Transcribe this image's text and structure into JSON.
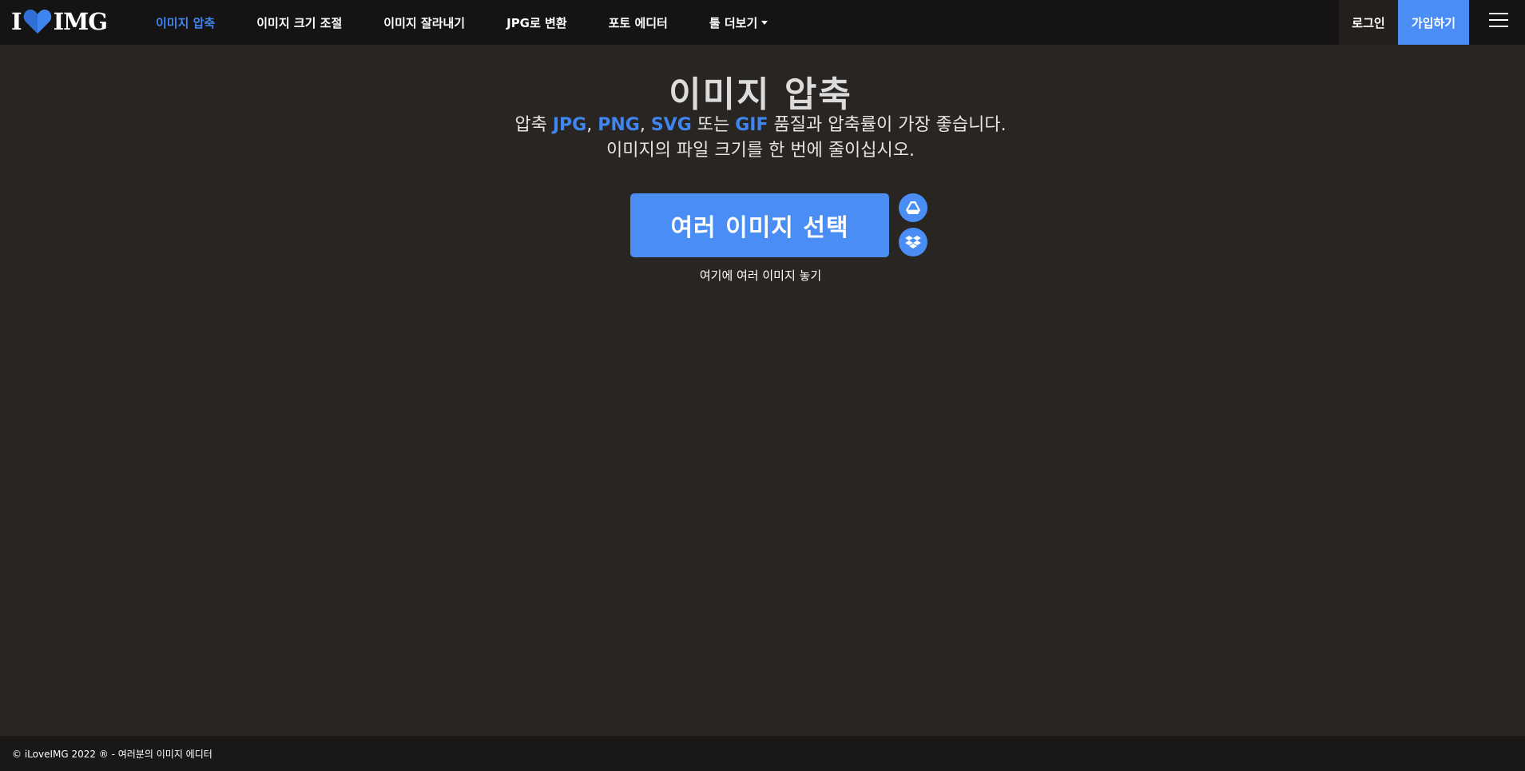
{
  "header": {
    "logo": {
      "left": "I",
      "right": "IMG"
    },
    "nav": [
      {
        "label": "이미지 압축",
        "active": true
      },
      {
        "label": "이미지 크기 조절"
      },
      {
        "label": "이미지 잘라내기"
      },
      {
        "label": "JPG로 변환"
      },
      {
        "label": "포토 에디터"
      },
      {
        "label": "툴 더보기",
        "dropdown": true
      }
    ],
    "login_label": "로그인",
    "signup_label": "가입하기",
    "menu_icon": "hamburger-menu-icon"
  },
  "main": {
    "title": "이미지 압축",
    "subtitle": {
      "prefix": "압축",
      "formats": [
        "JPG",
        "PNG",
        "SVG"
      ],
      "or": "또는",
      "last_format": "GIF",
      "suffix": "품질과 압축률이 가장 좋습니다.",
      "line2": "이미지의 파일 크기를 한 번에 줄이십시오."
    },
    "select_button_label": "여러 이미지 선택",
    "cloud_buttons": [
      "google-drive-icon",
      "dropbox-icon"
    ],
    "drop_hint": "여기에 여러 이미지 놓기"
  },
  "footer": {
    "text": "© iLoveIMG 2022 ® - 여러분의 이미지 에디터"
  },
  "colors": {
    "background": "#292522",
    "topbar": "#151313",
    "accent": "#4a8ef5",
    "accent_text": "#3f86f0",
    "footer": "#1a1817"
  }
}
